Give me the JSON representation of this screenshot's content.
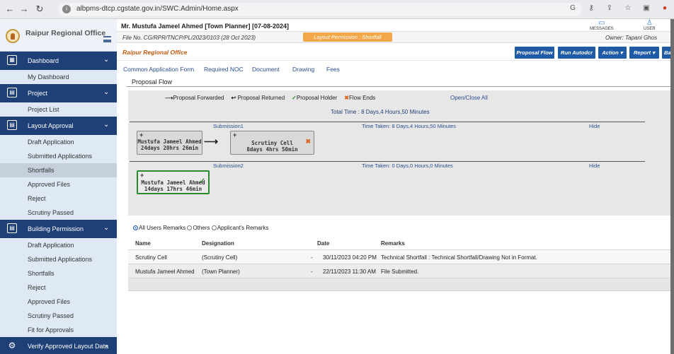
{
  "browser": {
    "url": "albpms-dtcp.cgstate.gov.in/SWC.Admin/Home.aspx"
  },
  "sidebar": {
    "brand": "Raipur Regional Office",
    "sections": [
      {
        "label": "Dashboard",
        "items": [
          "My Dashboard"
        ]
      },
      {
        "label": "Project",
        "items": [
          "Project List"
        ]
      },
      {
        "label": "Layout Approval",
        "items": [
          "Draft Application",
          "Submitted Applications",
          "Shortfalls",
          "Approved Files",
          "Reject",
          "Scrutiny Passed"
        ]
      },
      {
        "label": "Building Permission",
        "items": [
          "Draft Application",
          "Submitted Applications",
          "Shortfalls",
          "Reject",
          "Approved Files",
          "Scrutiny Passed",
          "Fit for Approvals"
        ]
      },
      {
        "label": "Verify Approved Layout Data",
        "items": []
      }
    ],
    "active_item": "Shortfalls"
  },
  "header": {
    "user_title": "Mr. Mustufa Jameel Ahmed [Town Planner] [07-08-2024]",
    "messages_label": "MESSAGES",
    "user_label": "USER",
    "file_no": "File No. CG/RPR/TNCP/PL/2023/0103 (28 Oct 2023)",
    "permission_badge": "Layout Permission : Shortfall",
    "owner": "Owner: Tapani Ghos",
    "office": "Raipur Regional Office"
  },
  "toolbar": {
    "proposal_flow": "Proposal Flow",
    "run_autodcr": "Run Autodcr",
    "action": "Action",
    "report": "Report",
    "back": "Back"
  },
  "tabs": [
    "Common Application Form",
    "Required NOC",
    "Document",
    "Drawing",
    "Fees"
  ],
  "proposal_flow": {
    "title": "Proposal Flow",
    "legend": {
      "forwarded": "Proposal Forwarded",
      "returned": "Proposal Returned",
      "holder": "Proposal Holder",
      "ends": "Flow Ends"
    },
    "open_close": "Open/Close All",
    "total_time": "Total Time : 8 Days,4 Hours,50 Minutes",
    "submissions": [
      {
        "label": "Submission1",
        "time_taken": "Time Taken: 8 Days,4 Hours,50 Minutes",
        "hide": "Hide",
        "nodes": [
          {
            "name": "Mustufa Jameel Ahmed",
            "duration": "24days 20hrs 26min"
          },
          {
            "name": "Scrutiny Cell",
            "duration": "8days 4hrs 50min"
          }
        ]
      },
      {
        "label": "Submission2",
        "time_taken": "Time Taken: 0 Days,0 Hours,0 Minutes",
        "hide": "Hide",
        "nodes": [
          {
            "name": "Mustufa Jameel Ahmed",
            "duration": "14days 17hrs 46min"
          }
        ]
      }
    ]
  },
  "remarks": {
    "options": [
      "All Users Remarks",
      "Others",
      "Applicant's Remarks"
    ],
    "selected": "All Users Remarks",
    "columns": [
      "Name",
      "Designation",
      "Date",
      "Remarks"
    ],
    "rows": [
      {
        "name": "Scrutiny  Cell",
        "designation": "(Scrutiny Cell)",
        "sep": "-",
        "date": "30/11/2023 04:20 PM",
        "remarks": "Technical Shortfall : Technical Shortfall/Drawing Not in Format."
      },
      {
        "name": "Mustufa Jameel Ahmed",
        "designation": "(Town Planner)",
        "sep": "-",
        "date": "22/11/2023 11:30 AM",
        "remarks": "File Submitted."
      }
    ]
  },
  "colors": {
    "sidebar_section": "#1f3f77",
    "toolbar_button": "#1f5aa6",
    "badge": "#f0a848",
    "office_text": "#c55a11",
    "holder_border": "#2a8a2a"
  }
}
